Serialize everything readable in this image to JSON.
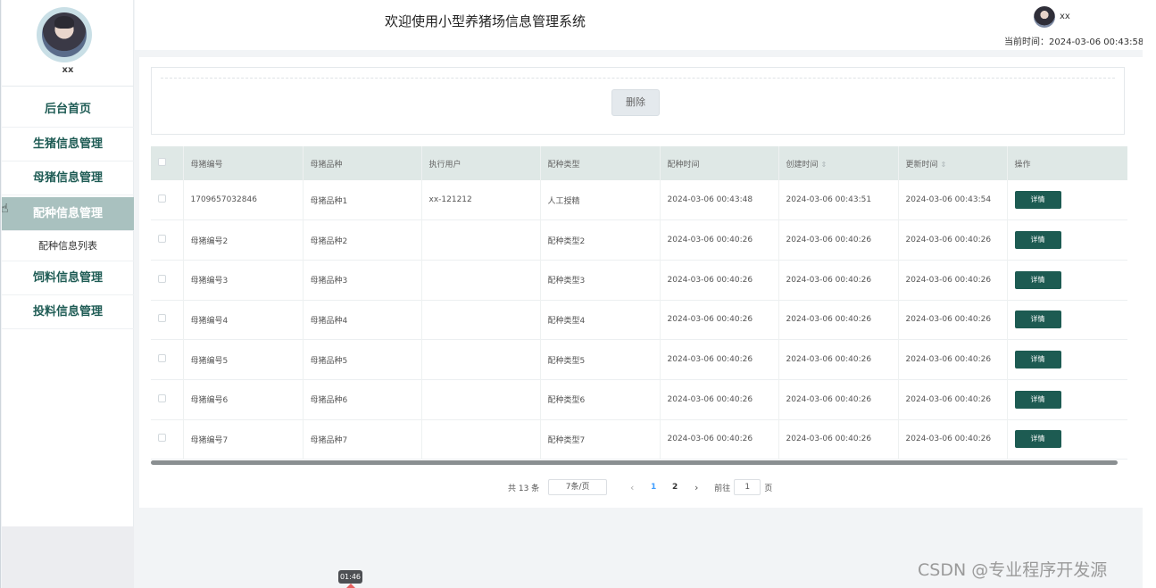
{
  "header": {
    "title": "欢迎使用小型养猪场信息管理系统",
    "username": "xx",
    "current_time_label": "当前时间：",
    "current_time": "2024-03-06 00:43:58"
  },
  "sidebar": {
    "username": "xx",
    "items": [
      {
        "label": "后台首页"
      },
      {
        "label": "生猪信息管理"
      },
      {
        "label": "母猪信息管理"
      },
      {
        "label": "配种信息管理"
      },
      {
        "label": "配种信息列表"
      },
      {
        "label": "饲料信息管理"
      },
      {
        "label": "投料信息管理"
      }
    ]
  },
  "toolbar": {
    "delete_label": "删除"
  },
  "table": {
    "columns": [
      "母猪编号",
      "母猪品种",
      "执行用户",
      "配种类型",
      "配种时间",
      "创建时间",
      "更新时间",
      "操作"
    ],
    "detail_label": "详情",
    "rows": [
      {
        "sow_no": "1709657032846",
        "breed": "母猪品种1",
        "user": "xx-121212",
        "type": "人工授精",
        "mating_time": "2024-03-06 00:43:48",
        "create_time": "2024-03-06 00:43:51",
        "update_time": "2024-03-06 00:43:54"
      },
      {
        "sow_no": "母猪编号2",
        "breed": "母猪品种2",
        "user": "",
        "type": "配种类型2",
        "mating_time": "2024-03-06 00:40:26",
        "create_time": "2024-03-06 00:40:26",
        "update_time": "2024-03-06 00:40:26"
      },
      {
        "sow_no": "母猪编号3",
        "breed": "母猪品种3",
        "user": "",
        "type": "配种类型3",
        "mating_time": "2024-03-06 00:40:26",
        "create_time": "2024-03-06 00:40:26",
        "update_time": "2024-03-06 00:40:26"
      },
      {
        "sow_no": "母猪编号4",
        "breed": "母猪品种4",
        "user": "",
        "type": "配种类型4",
        "mating_time": "2024-03-06 00:40:26",
        "create_time": "2024-03-06 00:40:26",
        "update_time": "2024-03-06 00:40:26"
      },
      {
        "sow_no": "母猪编号5",
        "breed": "母猪品种5",
        "user": "",
        "type": "配种类型5",
        "mating_time": "2024-03-06 00:40:26",
        "create_time": "2024-03-06 00:40:26",
        "update_time": "2024-03-06 00:40:26"
      },
      {
        "sow_no": "母猪编号6",
        "breed": "母猪品种6",
        "user": "",
        "type": "配种类型6",
        "mating_time": "2024-03-06 00:40:26",
        "create_time": "2024-03-06 00:40:26",
        "update_time": "2024-03-06 00:40:26"
      },
      {
        "sow_no": "母猪编号7",
        "breed": "母猪品种7",
        "user": "",
        "type": "配种类型7",
        "mating_time": "2024-03-06 00:40:26",
        "create_time": "2024-03-06 00:40:26",
        "update_time": "2024-03-06 00:40:26"
      }
    ]
  },
  "pagination": {
    "total_text": "共 13 条",
    "page_size_text": "7条/页",
    "pages": [
      "1",
      "2"
    ],
    "current_page": "1",
    "goto_label": "前往",
    "goto_value": "1",
    "goto_suffix": "页"
  },
  "video": {
    "timestamp": "01:46"
  },
  "watermark": "CSDN @专业程序开发源",
  "colors": {
    "accent": "#1d5b52",
    "menu_active_bg": "#a9c1bf",
    "table_header_bg": "#dfe8e6",
    "current_page": "#409eff"
  }
}
